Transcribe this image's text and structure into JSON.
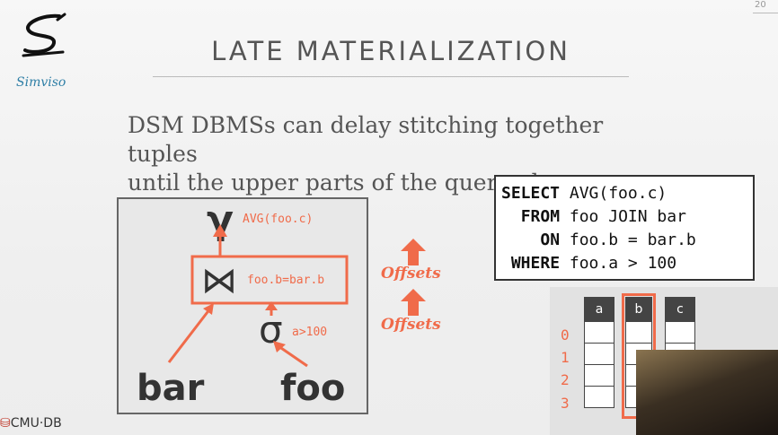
{
  "slide": {
    "logo_text": "Simviso",
    "page_number": "20",
    "title": "LATE MATERIALIZATION",
    "body_lines": [
      "DSM DBMSs can delay stitching together tuples",
      "until the upper parts of the query plan."
    ],
    "footer": "CMU·DB"
  },
  "plan": {
    "gamma_symbol": "γ",
    "gamma_label": "AVG(foo.c)",
    "join_symbol": "⋈",
    "join_label": "foo.b=bar.b",
    "sigma_symbol": "σ",
    "sigma_label": "a>100",
    "left_table": "bar",
    "right_table": "foo",
    "offsets_labels": [
      "Offsets",
      "Offsets"
    ]
  },
  "sql": {
    "lines": [
      {
        "kw": "SELECT",
        "rest": " AVG(foo.c)",
        "indent": ""
      },
      {
        "kw": "FROM",
        "rest": " foo JOIN bar",
        "indent": "  "
      },
      {
        "kw": "ON",
        "rest": " foo.b = bar.b",
        "indent": "    "
      },
      {
        "kw": "WHERE",
        "rest": " foo.a > 100",
        "indent": " "
      }
    ]
  },
  "columns": {
    "headers": [
      "a",
      "b",
      "c"
    ],
    "row_indexes": [
      "0",
      "1",
      "2",
      "3"
    ]
  },
  "colors": {
    "accent": "#f06b4a",
    "dark": "#444444"
  }
}
